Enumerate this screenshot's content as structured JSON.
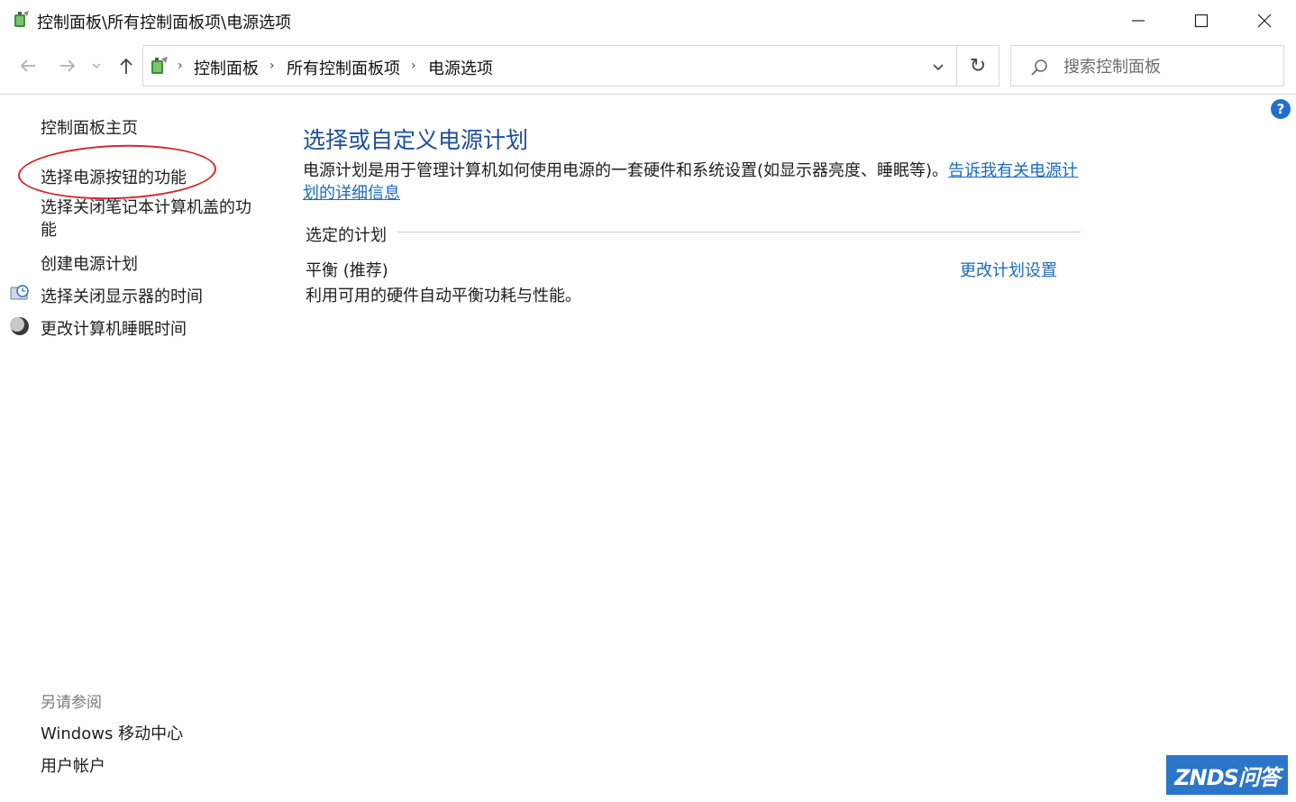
{
  "window": {
    "title": "控制面板\\所有控制面板项\\电源选项",
    "controls": {
      "minimize": "minimize-icon",
      "maximize": "maximize-icon",
      "close": "close-icon"
    }
  },
  "address": {
    "breadcrumbs": [
      "控制面板",
      "所有控制面板项",
      "电源选项"
    ],
    "search_placeholder": "搜索控制面板"
  },
  "sidebar": {
    "items": [
      {
        "label": "控制面板主页"
      },
      {
        "label": "选择电源按钮的功能",
        "highlighted": true
      },
      {
        "label": "选择关闭笔记本计算机盖的功能"
      },
      {
        "label": "创建电源计划"
      },
      {
        "label": "选择关闭显示器的时间",
        "icon": "monitor-clock-icon"
      },
      {
        "label": "更改计算机睡眠时间",
        "icon": "moon-icon"
      }
    ],
    "see_also_label": "另请参阅",
    "see_also": [
      {
        "label": "Windows 移动中心"
      },
      {
        "label": "用户帐户"
      }
    ]
  },
  "main": {
    "title": "选择或自定义电源计划",
    "description": "电源计划是用于管理计算机如何使用电源的一套硬件和系统设置(如显示器亮度、睡眠等)。",
    "description_link": "告诉我有关电源计划的详细信息",
    "section_label": "选定的计划",
    "plan": {
      "name": "平衡 (推荐)",
      "change_link": "更改计划设置",
      "description": "利用可用的硬件自动平衡功耗与性能。"
    }
  },
  "help_label": "?",
  "watermark": "ZNDS问答",
  "colors": {
    "link": "#1a6ac0",
    "title": "#1f4e9c",
    "highlight": "#d6252b"
  }
}
